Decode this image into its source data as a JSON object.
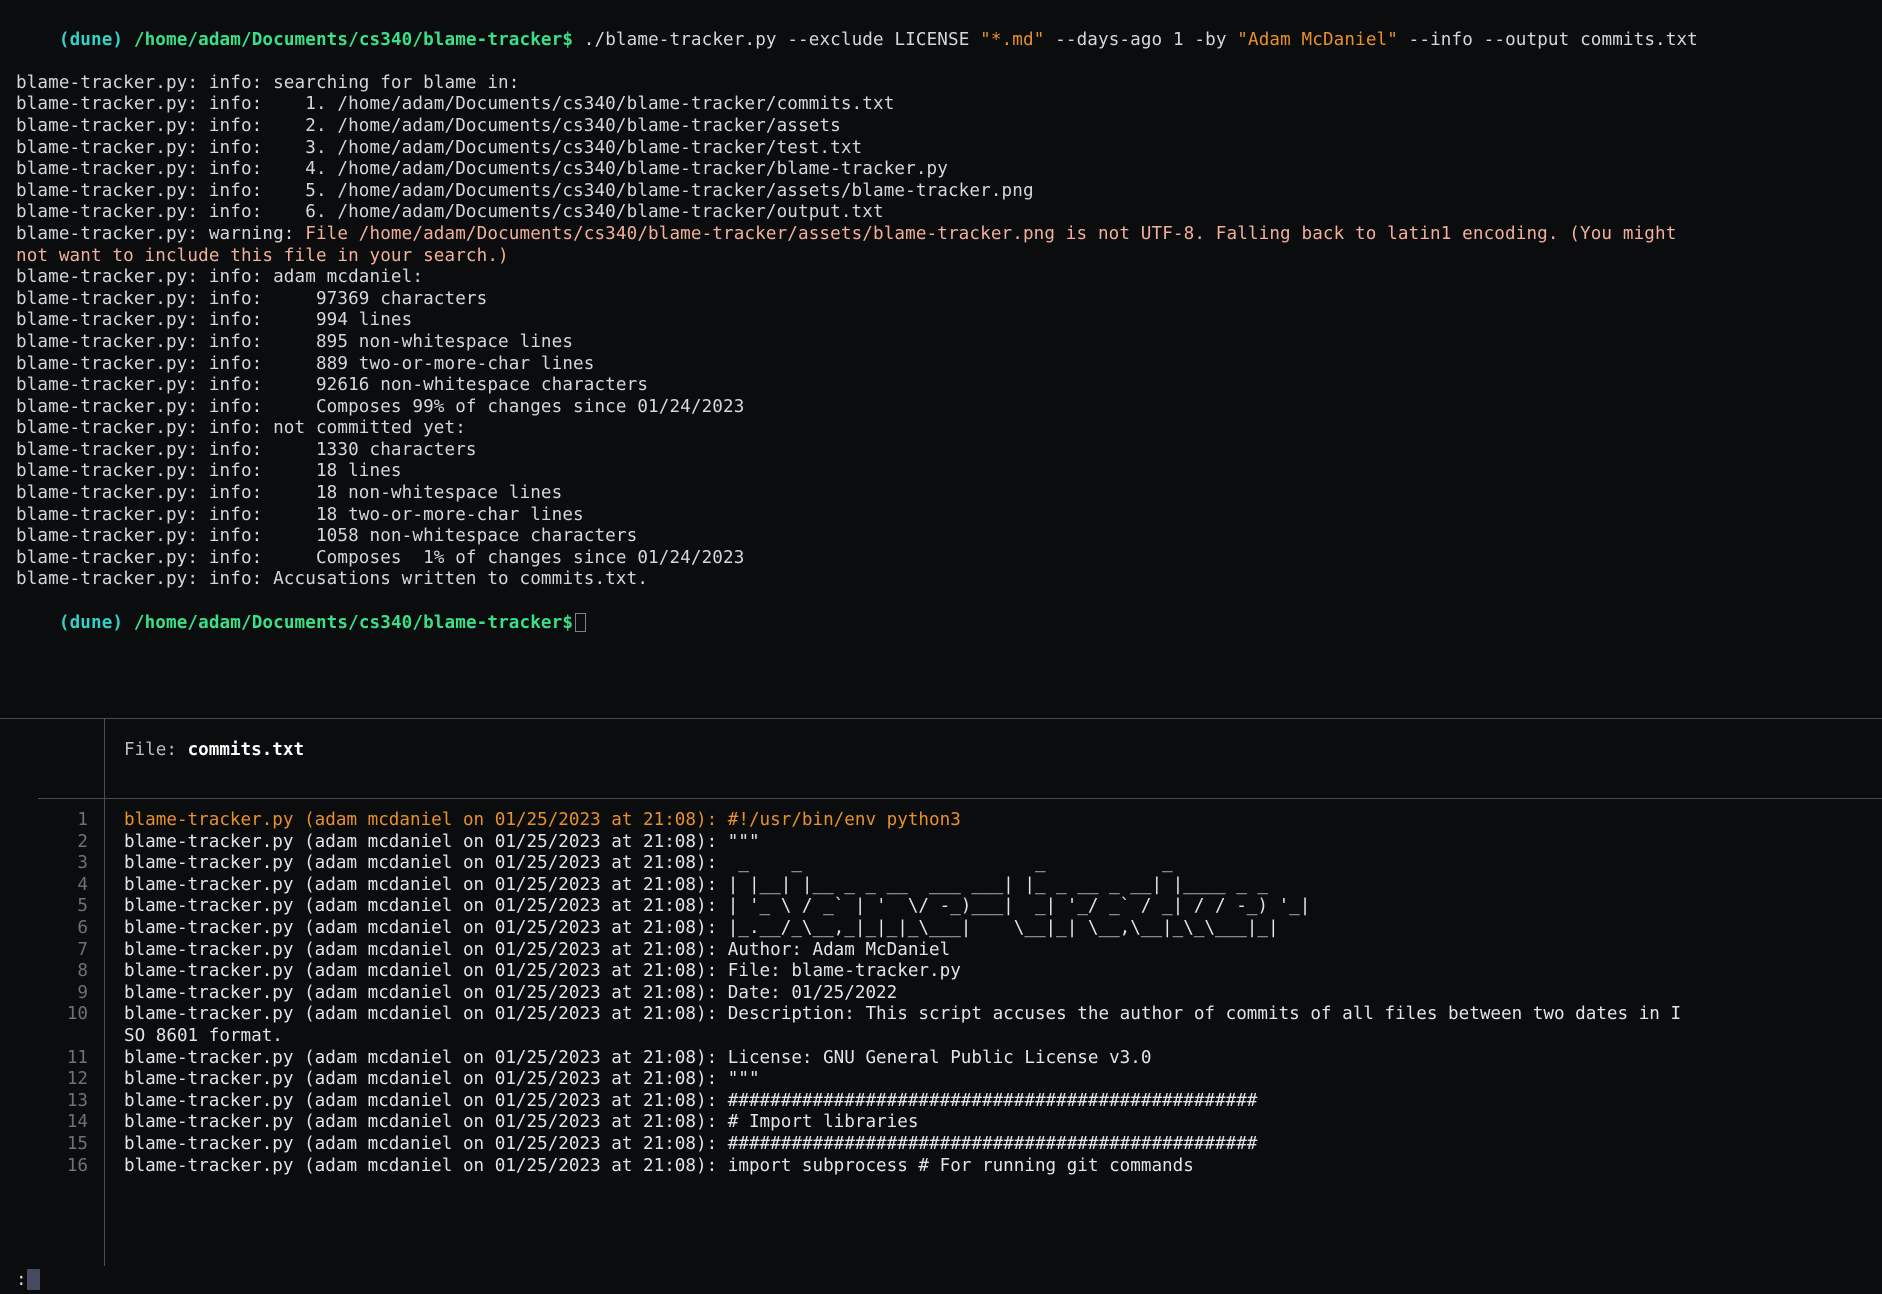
{
  "terminal": {
    "prompt": {
      "env": "(dune)",
      "path": "/home/adam/Documents/cs340/blame-tracker$",
      "command_plain_1": " ./blame-tracker.py --exclude LICENSE ",
      "command_quoted_1": "\"*.md\"",
      "command_plain_2": " --days-ago 1 -by ",
      "command_quoted_2": "\"Adam McDaniel\"",
      "command_plain_3": " --info --output commits.txt"
    },
    "output_lines": [
      "blame-tracker.py: info: searching for blame in:",
      "blame-tracker.py: info:    1. /home/adam/Documents/cs340/blame-tracker/commits.txt",
      "blame-tracker.py: info:    2. /home/adam/Documents/cs340/blame-tracker/assets",
      "blame-tracker.py: info:    3. /home/adam/Documents/cs340/blame-tracker/test.txt",
      "blame-tracker.py: info:    4. /home/adam/Documents/cs340/blame-tracker/blame-tracker.py",
      "blame-tracker.py: info:    5. /home/adam/Documents/cs340/blame-tracker/assets/blame-tracker.png",
      "blame-tracker.py: info:    6. /home/adam/Documents/cs340/blame-tracker/output.txt"
    ],
    "warning": {
      "prefix": "blame-tracker.py: warning: ",
      "text_line1": "File /home/adam/Documents/cs340/blame-tracker/assets/blame-tracker.png is not UTF-8. Falling back to latin1 encoding. (You might",
      "text_line2": "not want to include this file in your search.)"
    },
    "stats_lines": [
      "blame-tracker.py: info: adam mcdaniel:",
      "blame-tracker.py: info:     97369 characters",
      "blame-tracker.py: info:     994 lines",
      "blame-tracker.py: info:     895 non-whitespace lines",
      "blame-tracker.py: info:     889 two-or-more-char lines",
      "blame-tracker.py: info:     92616 non-whitespace characters",
      "blame-tracker.py: info:     Composes 99% of changes since 01/24/2023",
      "blame-tracker.py: info: not committed yet:",
      "blame-tracker.py: info:     1330 characters",
      "blame-tracker.py: info:     18 lines",
      "blame-tracker.py: info:     18 non-whitespace lines",
      "blame-tracker.py: info:     18 two-or-more-char lines",
      "blame-tracker.py: info:     1058 non-whitespace characters",
      "blame-tracker.py: info:     Composes  1% of changes since 01/24/2023",
      "blame-tracker.py: info: Accusations written to commits.txt."
    ],
    "final_prompt": {
      "env": "(dune)",
      "path": "/home/adam/Documents/cs340/blame-tracker$"
    }
  },
  "viewer": {
    "header_label": "File: ",
    "filename": "commits.txt",
    "blame_prefix": "blame-tracker.py (adam mcdaniel on 01/25/2023 at 21:08): ",
    "rows": [
      {
        "num": "1",
        "text": "blame-tracker.py (adam mcdaniel on 01/25/2023 at 21:08): #!/usr/bin/env python3",
        "highlight": true
      },
      {
        "num": "2",
        "text": "blame-tracker.py (adam mcdaniel on 01/25/2023 at 21:08): \"\"\"",
        "highlight": false
      },
      {
        "num": "3",
        "text": "blame-tracker.py (adam mcdaniel on 01/25/2023 at 21:08):  _    _                      _           _",
        "highlight": false
      },
      {
        "num": "4",
        "text": "blame-tracker.py (adam mcdaniel on 01/25/2023 at 21:08): | |__| |__ _ _ __  ___ ___| |_ _ __ _ __| |____ _ _",
        "highlight": false
      },
      {
        "num": "5",
        "text": "blame-tracker.py (adam mcdaniel on 01/25/2023 at 21:08): | '_ \\ / _` | '  \\/ -_)___|  _| '_/ _` / _| / / -_) '_|",
        "highlight": false
      },
      {
        "num": "6",
        "text": "blame-tracker.py (adam mcdaniel on 01/25/2023 at 21:08): |_.__/_\\__,_|_|_|_\\___|    \\__|_| \\__,\\__|_\\_\\___|_|",
        "highlight": false
      },
      {
        "num": "7",
        "text": "blame-tracker.py (adam mcdaniel on 01/25/2023 at 21:08): Author: Adam McDaniel",
        "highlight": false
      },
      {
        "num": "8",
        "text": "blame-tracker.py (adam mcdaniel on 01/25/2023 at 21:08): File: blame-tracker.py",
        "highlight": false
      },
      {
        "num": "9",
        "text": "blame-tracker.py (adam mcdaniel on 01/25/2023 at 21:08): Date: 01/25/2022",
        "highlight": false
      },
      {
        "num": "10",
        "text": "blame-tracker.py (adam mcdaniel on 01/25/2023 at 21:08): Description: This script accuses the author of commits of all files between two dates in I",
        "highlight": false
      },
      {
        "num": "",
        "text": "SO 8601 format.",
        "highlight": false,
        "continuation": true
      },
      {
        "num": "11",
        "text": "blame-tracker.py (adam mcdaniel on 01/25/2023 at 21:08): License: GNU General Public License v3.0",
        "highlight": false
      },
      {
        "num": "12",
        "text": "blame-tracker.py (adam mcdaniel on 01/25/2023 at 21:08): \"\"\"",
        "highlight": false
      },
      {
        "num": "13",
        "text": "blame-tracker.py (adam mcdaniel on 01/25/2023 at 21:08): ##################################################",
        "highlight": false
      },
      {
        "num": "14",
        "text": "blame-tracker.py (adam mcdaniel on 01/25/2023 at 21:08): # Import libraries",
        "highlight": false
      },
      {
        "num": "15",
        "text": "blame-tracker.py (adam mcdaniel on 01/25/2023 at 21:08): ##################################################",
        "highlight": false
      },
      {
        "num": "16",
        "text": "blame-tracker.py (adam mcdaniel on 01/25/2023 at 21:08): import subprocess # For running git commands",
        "highlight": false
      }
    ]
  },
  "pager": {
    "prompt": ":"
  },
  "colors": {
    "background": "#0b0c0e",
    "foreground": "#d6d7da",
    "prompt_env": "#34d2c6",
    "prompt_path": "#3ae089",
    "string_arg": "#e8902a",
    "warning": "#f2b09a",
    "gutter": "#6e717a",
    "border": "#4a4d55"
  }
}
